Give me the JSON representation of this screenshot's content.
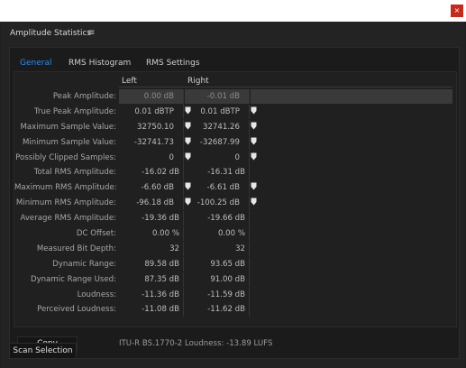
{
  "window": {
    "close_glyph": "×"
  },
  "panel": {
    "title": "Amplitude Statistics",
    "menu_glyph": "≡"
  },
  "tabs": [
    {
      "label": "General",
      "active": true
    },
    {
      "label": "RMS Histogram",
      "active": false
    },
    {
      "label": "RMS Settings",
      "active": false
    }
  ],
  "columns": {
    "left": "Left",
    "right": "Right"
  },
  "rows": [
    {
      "label": "Peak Amplitude:",
      "left": "0.00 dB",
      "right": "-0.01 dB",
      "left_pin": true,
      "right_pin": true,
      "selected": true,
      "dim": true
    },
    {
      "label": "True Peak Amplitude:",
      "left": "0.01 dBTP",
      "right": "0.01 dBTP",
      "left_pin": true,
      "right_pin": true
    },
    {
      "label": "Maximum Sample Value:",
      "left": "32750.10",
      "right": "32741.26",
      "left_pin": true,
      "right_pin": true
    },
    {
      "label": "Minimum Sample Value:",
      "left": "-32741.73",
      "right": "-32687.99",
      "left_pin": true,
      "right_pin": true
    },
    {
      "label": "Possibly Clipped Samples:",
      "left": "0",
      "right": "0",
      "left_pin": true,
      "right_pin": true
    },
    {
      "label": "Total RMS Amplitude:",
      "left": "-16.02 dB",
      "right": "-16.31 dB",
      "left_pin": false,
      "right_pin": false
    },
    {
      "label": "Maximum RMS Amplitude:",
      "left": "-6.60 dB",
      "right": "-6.61 dB",
      "left_pin": true,
      "right_pin": true
    },
    {
      "label": "Minimum RMS Amplitude:",
      "left": "-96.18 dB",
      "right": "-100.25 dB",
      "left_pin": true,
      "right_pin": true
    },
    {
      "label": "Average RMS Amplitude:",
      "left": "-19.36 dB",
      "right": "-19.66 dB",
      "left_pin": false,
      "right_pin": false
    },
    {
      "label": "DC Offset:",
      "left": "0.00 %",
      "right": "0.00 %",
      "left_pin": false,
      "right_pin": false
    },
    {
      "label": "Measured Bit Depth:",
      "left": "32",
      "right": "32",
      "left_pin": false,
      "right_pin": false
    },
    {
      "label": "Dynamic Range:",
      "left": "89.58 dB",
      "right": "93.65 dB",
      "left_pin": false,
      "right_pin": false
    },
    {
      "label": "Dynamic Range Used:",
      "left": "87.35 dB",
      "right": "91.00 dB",
      "left_pin": false,
      "right_pin": false
    },
    {
      "label": "Loudness:",
      "left": "-11.36 dB",
      "right": "-11.59 dB",
      "left_pin": false,
      "right_pin": false
    },
    {
      "label": "Perceived Loudness:",
      "left": "-11.08 dB",
      "right": "-11.62 dB",
      "left_pin": false,
      "right_pin": false
    }
  ],
  "pin_glyph": "⬤",
  "copy_label": "Copy",
  "loudness_text": "ITU-R BS.1770-2 Loudness: -13.89 LUFS",
  "scan_label": "Scan Selection",
  "colors": {
    "accent": "#2d8ceb",
    "close": "#c42b1c",
    "background": "#1e1e1e"
  }
}
